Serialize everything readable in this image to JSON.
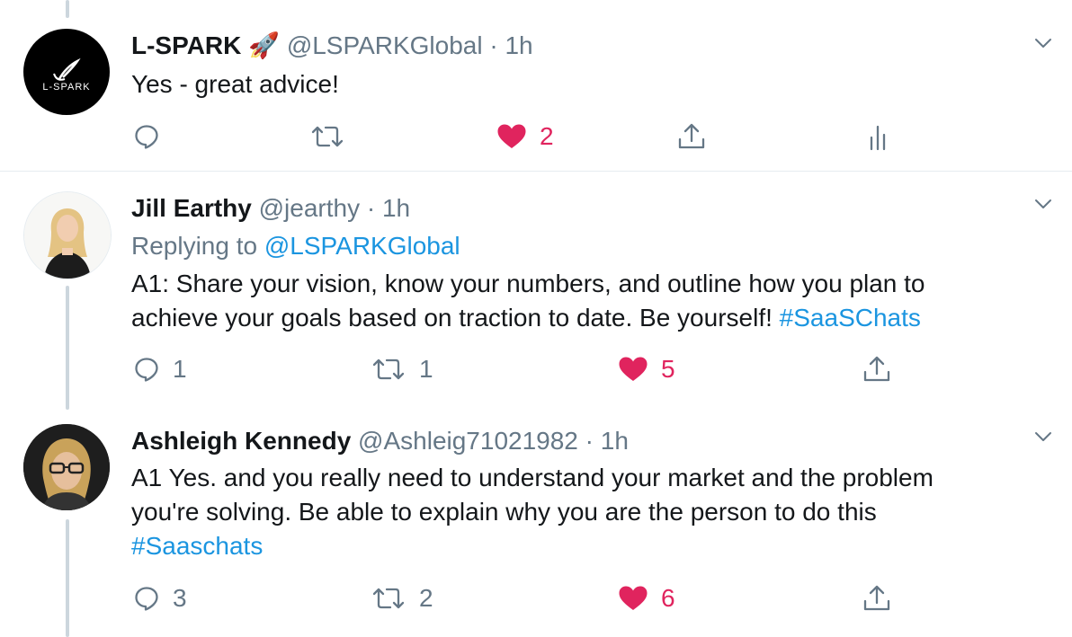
{
  "tweets": [
    {
      "name": "L-SPARK",
      "emoji": "🚀",
      "handle": "@LSPARKGlobal",
      "separator": "·",
      "time": "1h",
      "avatar_label": "L-SPARK",
      "text": "Yes - great advice!",
      "actions": {
        "replies": "",
        "retweets": "",
        "likes": "2"
      }
    },
    {
      "name": "Jill Earthy",
      "handle": "@jearthy",
      "separator": "·",
      "time": "1h",
      "replying_prefix": "Replying to",
      "replying_handle": "@LSPARKGlobal",
      "text_lines": [
        "A1: Share your vision, know your numbers, and outline how you plan to",
        "achieve your goals based on traction to date. Be yourself! "
      ],
      "hashtag": "#SaaSChats",
      "actions": {
        "replies": "1",
        "retweets": "1",
        "likes": "5"
      }
    },
    {
      "name": "Ashleigh Kennedy",
      "handle": "@Ashleig71021982",
      "separator": "·",
      "time": "1h",
      "text_lines": [
        "A1 Yes. and you really need to understand your market and the problem",
        "you're solving. Be able to explain why you are the person to do this"
      ],
      "hashtag": "#Saaschats",
      "actions": {
        "replies": "3",
        "retweets": "2",
        "likes": "6"
      }
    }
  ],
  "colors": {
    "like_red": "#e0245e",
    "link_blue": "#1b95e0",
    "muted": "#657786",
    "thread_line": "#ccd6dd"
  },
  "icons": [
    "reply-icon",
    "retweet-icon",
    "like-icon",
    "share-icon",
    "analytics-icon",
    "chevron-down-icon"
  ]
}
